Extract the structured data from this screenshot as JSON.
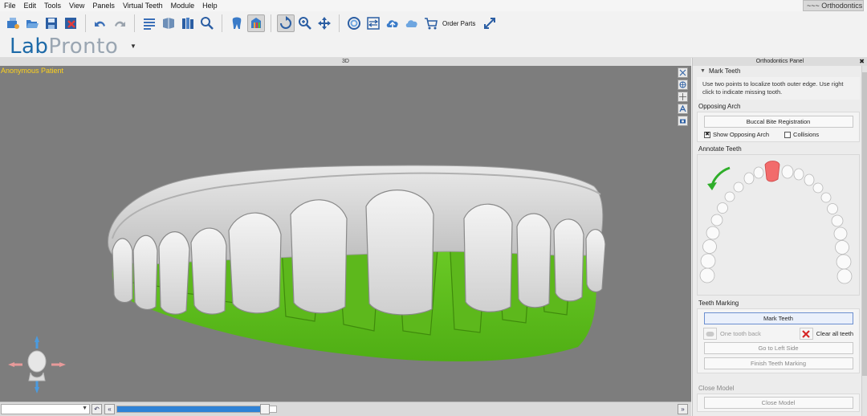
{
  "menu": [
    "File",
    "Edit",
    "Tools",
    "View",
    "Panels",
    "Virtual Teeth",
    "Module",
    "Help"
  ],
  "module_tab": "~~~ Orthodontics",
  "toolbar": {
    "order_parts_label": "Order Parts",
    "icons": [
      "open-icon",
      "open-folder-icon",
      "save-icon",
      "close-case-icon",
      "undo-icon",
      "redo-icon",
      "list-icon",
      "scan-icon",
      "library-icon",
      "zoom-fit-icon",
      "tooth-icon",
      "palette-icon",
      "rotate-icon",
      "zoom-in-icon",
      "pan-icon",
      "swirl-icon",
      "compare-icon",
      "upload-cloud-icon",
      "cloud-icon",
      "cart-icon",
      "fullscreen-icon"
    ]
  },
  "logo": {
    "part1": "Lab",
    "part2": "Pronto"
  },
  "viewport": {
    "header": "3D",
    "patient": "Anonymous Patient",
    "tools": [
      "measure-icon",
      "globe-icon",
      "crosshair-icon",
      "annotate-icon",
      "camera-icon"
    ]
  },
  "bottom": {
    "slider_value": 0.93
  },
  "panel": {
    "title": "Orthodontics Panel",
    "close": "✖",
    "mark_teeth_section": "Mark Teeth",
    "instructions": "Use two points to localize tooth outer edge. Use right click to indicate missing tooth.",
    "opposing_arch": {
      "label": "Opposing Arch",
      "buccal_button": "Buccal Bite Registration",
      "show_opposing_label": "Show Opposing Arch",
      "show_opposing_checked": true,
      "collisions_label": "Collisions",
      "collisions_checked": false
    },
    "annotate_label": "Annotate Teeth",
    "teeth_marking": {
      "label": "Teeth Marking",
      "mark_button": "Mark Teeth",
      "one_tooth_back": "One tooth back",
      "clear_all": "Clear all teeth",
      "go_left": "Go to Left Side",
      "finish": "Finish Teeth Marking"
    },
    "close_model": {
      "label": "Close Model",
      "button": "Close Model"
    }
  },
  "colors": {
    "accent": "#2f82d6",
    "gum_green": "#5fbf1a",
    "marked_tooth": "#f26b6b",
    "patient_text": "#ffd21a",
    "arrow_green": "#2fae2a"
  }
}
